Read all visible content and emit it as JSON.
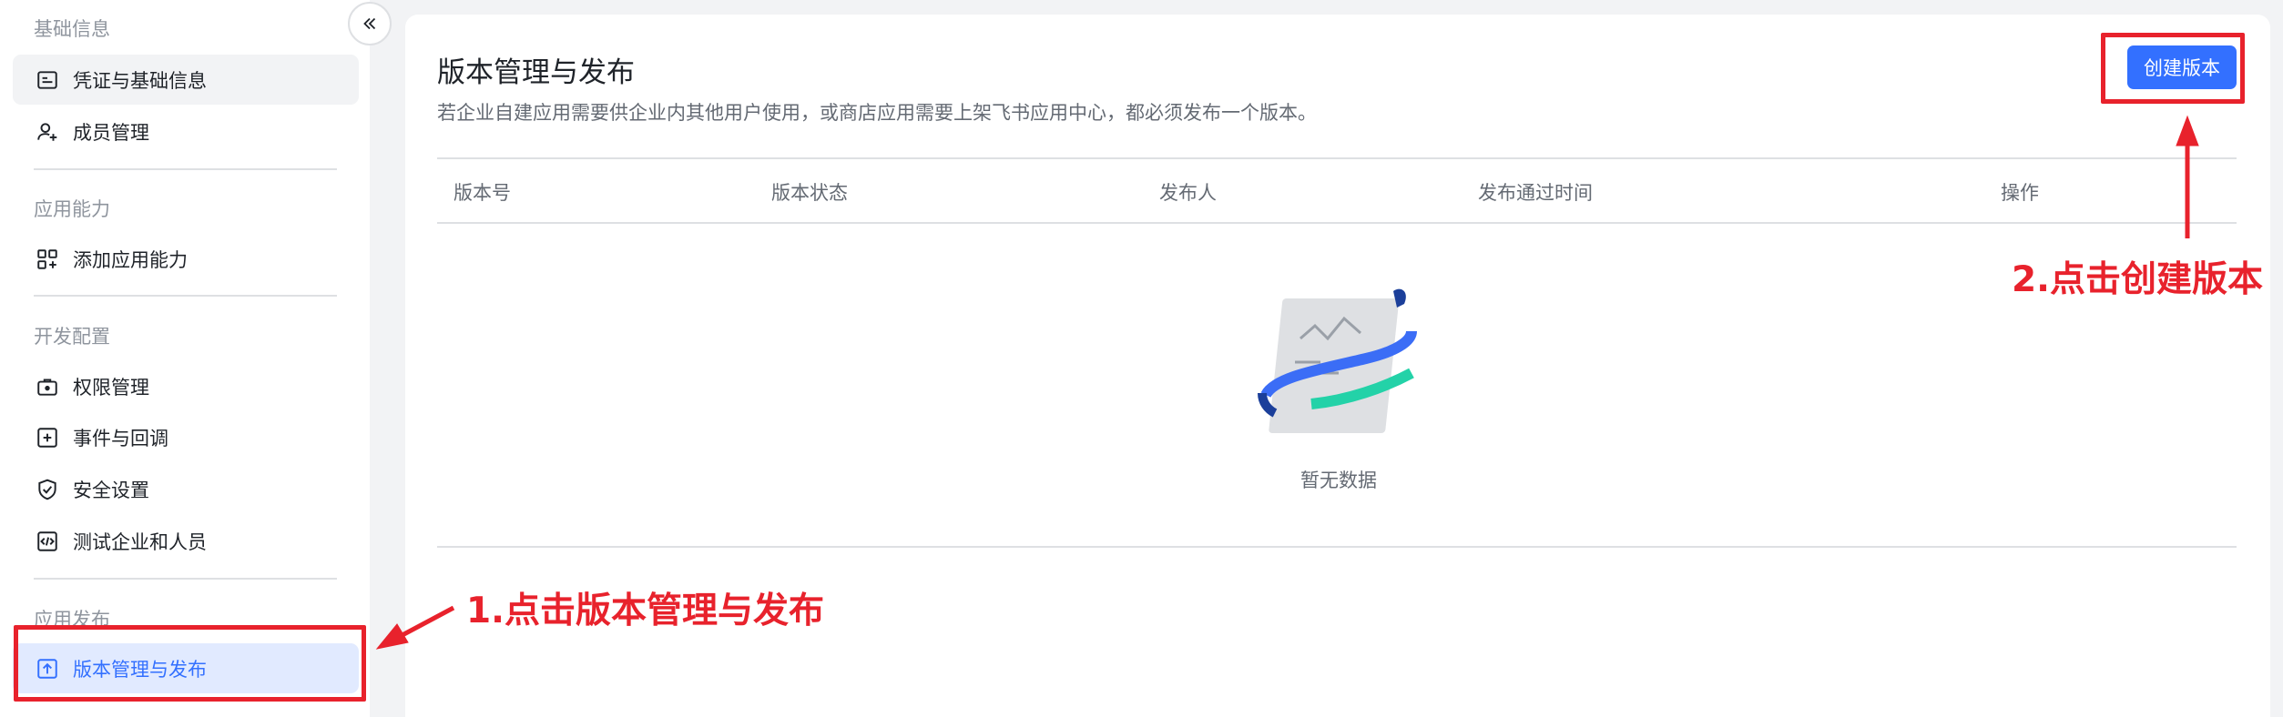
{
  "sidebar": {
    "groups": [
      {
        "title": "基础信息"
      },
      {
        "title": "应用能力"
      },
      {
        "title": "开发配置"
      },
      {
        "title": "应用发布"
      }
    ],
    "items": [
      {
        "label": "凭证与基础信息",
        "icon": "id-card-icon"
      },
      {
        "label": "成员管理",
        "icon": "user-add-icon"
      },
      {
        "label": "添加应用能力",
        "icon": "apps-add-icon"
      },
      {
        "label": "权限管理",
        "icon": "briefcase-lock-icon"
      },
      {
        "label": "事件与回调",
        "icon": "event-add-icon"
      },
      {
        "label": "安全设置",
        "icon": "shield-check-icon"
      },
      {
        "label": "测试企业和人员",
        "icon": "code-box-icon"
      },
      {
        "label": "版本管理与发布",
        "icon": "upload-box-icon"
      }
    ],
    "collapse_icon": "double-chevron-left-icon"
  },
  "main": {
    "title": "版本管理与发布",
    "description": "若企业自建应用需要供企业内其他用户使用，或商店应用需要上架飞书应用中心，都必须发布一个版本。",
    "create_button": "创建版本",
    "table": {
      "columns": [
        "版本号",
        "版本状态",
        "发布人",
        "发布通过时间",
        "操作"
      ],
      "rows": [],
      "empty_text": "暂无数据"
    }
  },
  "annotations": {
    "step1": "1.点击版本管理与发布",
    "step2": "2.点击创建版本",
    "color": "#e8222c"
  },
  "colors": {
    "accent": "#3370ff",
    "active_bg": "#e1eaff",
    "text_primary": "#1f2329",
    "text_secondary": "#646a73",
    "text_muted": "#8f959e"
  }
}
